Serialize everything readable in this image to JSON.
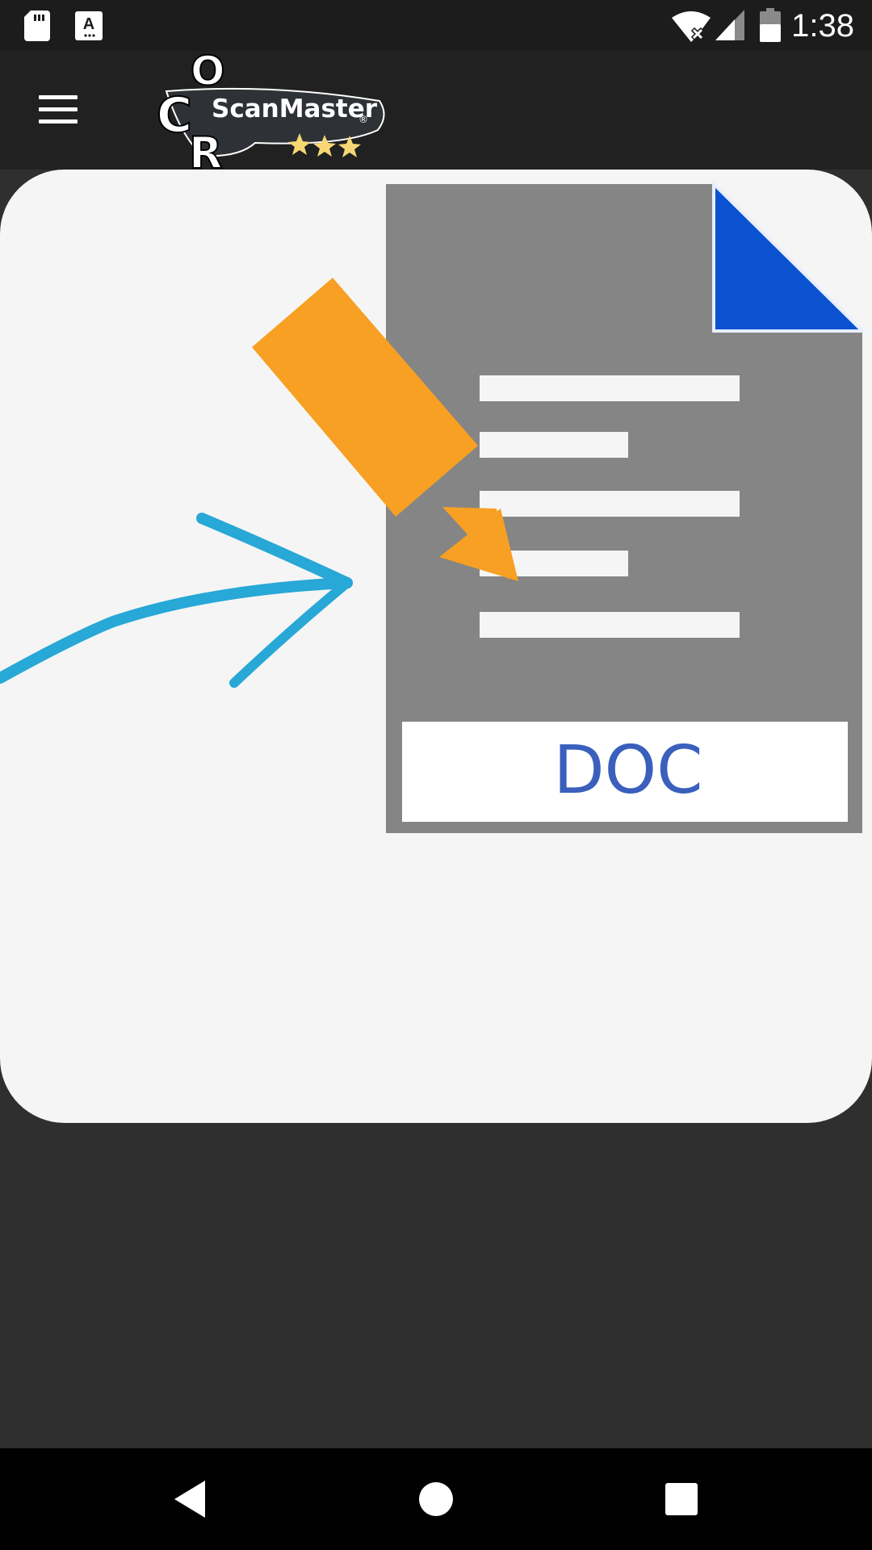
{
  "status_bar": {
    "time": "1:38",
    "icons": [
      "sd-card-icon",
      "a-notification-icon",
      "wifi-off-icon",
      "cell-signal-icon",
      "battery-icon"
    ]
  },
  "app_bar": {
    "menu_icon": "hamburger-menu-icon",
    "logo": {
      "letters": [
        "C",
        "O",
        "R"
      ],
      "name": "ScanMaster",
      "registered_mark": "®",
      "stars": 3
    }
  },
  "illustration": {
    "doc_label": "DOC",
    "icons": [
      "arrow-icon",
      "pencil-icon",
      "document-icon"
    ]
  },
  "nav_bar": {
    "buttons": [
      "back-icon",
      "home-icon",
      "recents-icon"
    ]
  },
  "colors": {
    "status_bar_bg": "#1c1c1c",
    "app_bar_bg": "#212121",
    "screen_bg": "#2f2f2f",
    "card_bg": "#f5f5f5",
    "doc_gray": "#858585",
    "fold_blue": "#0a52d0",
    "pencil_orange": "#f7a023",
    "arrow_cyan": "#27a8d6",
    "doc_label_blue": "#3a5fbd"
  }
}
